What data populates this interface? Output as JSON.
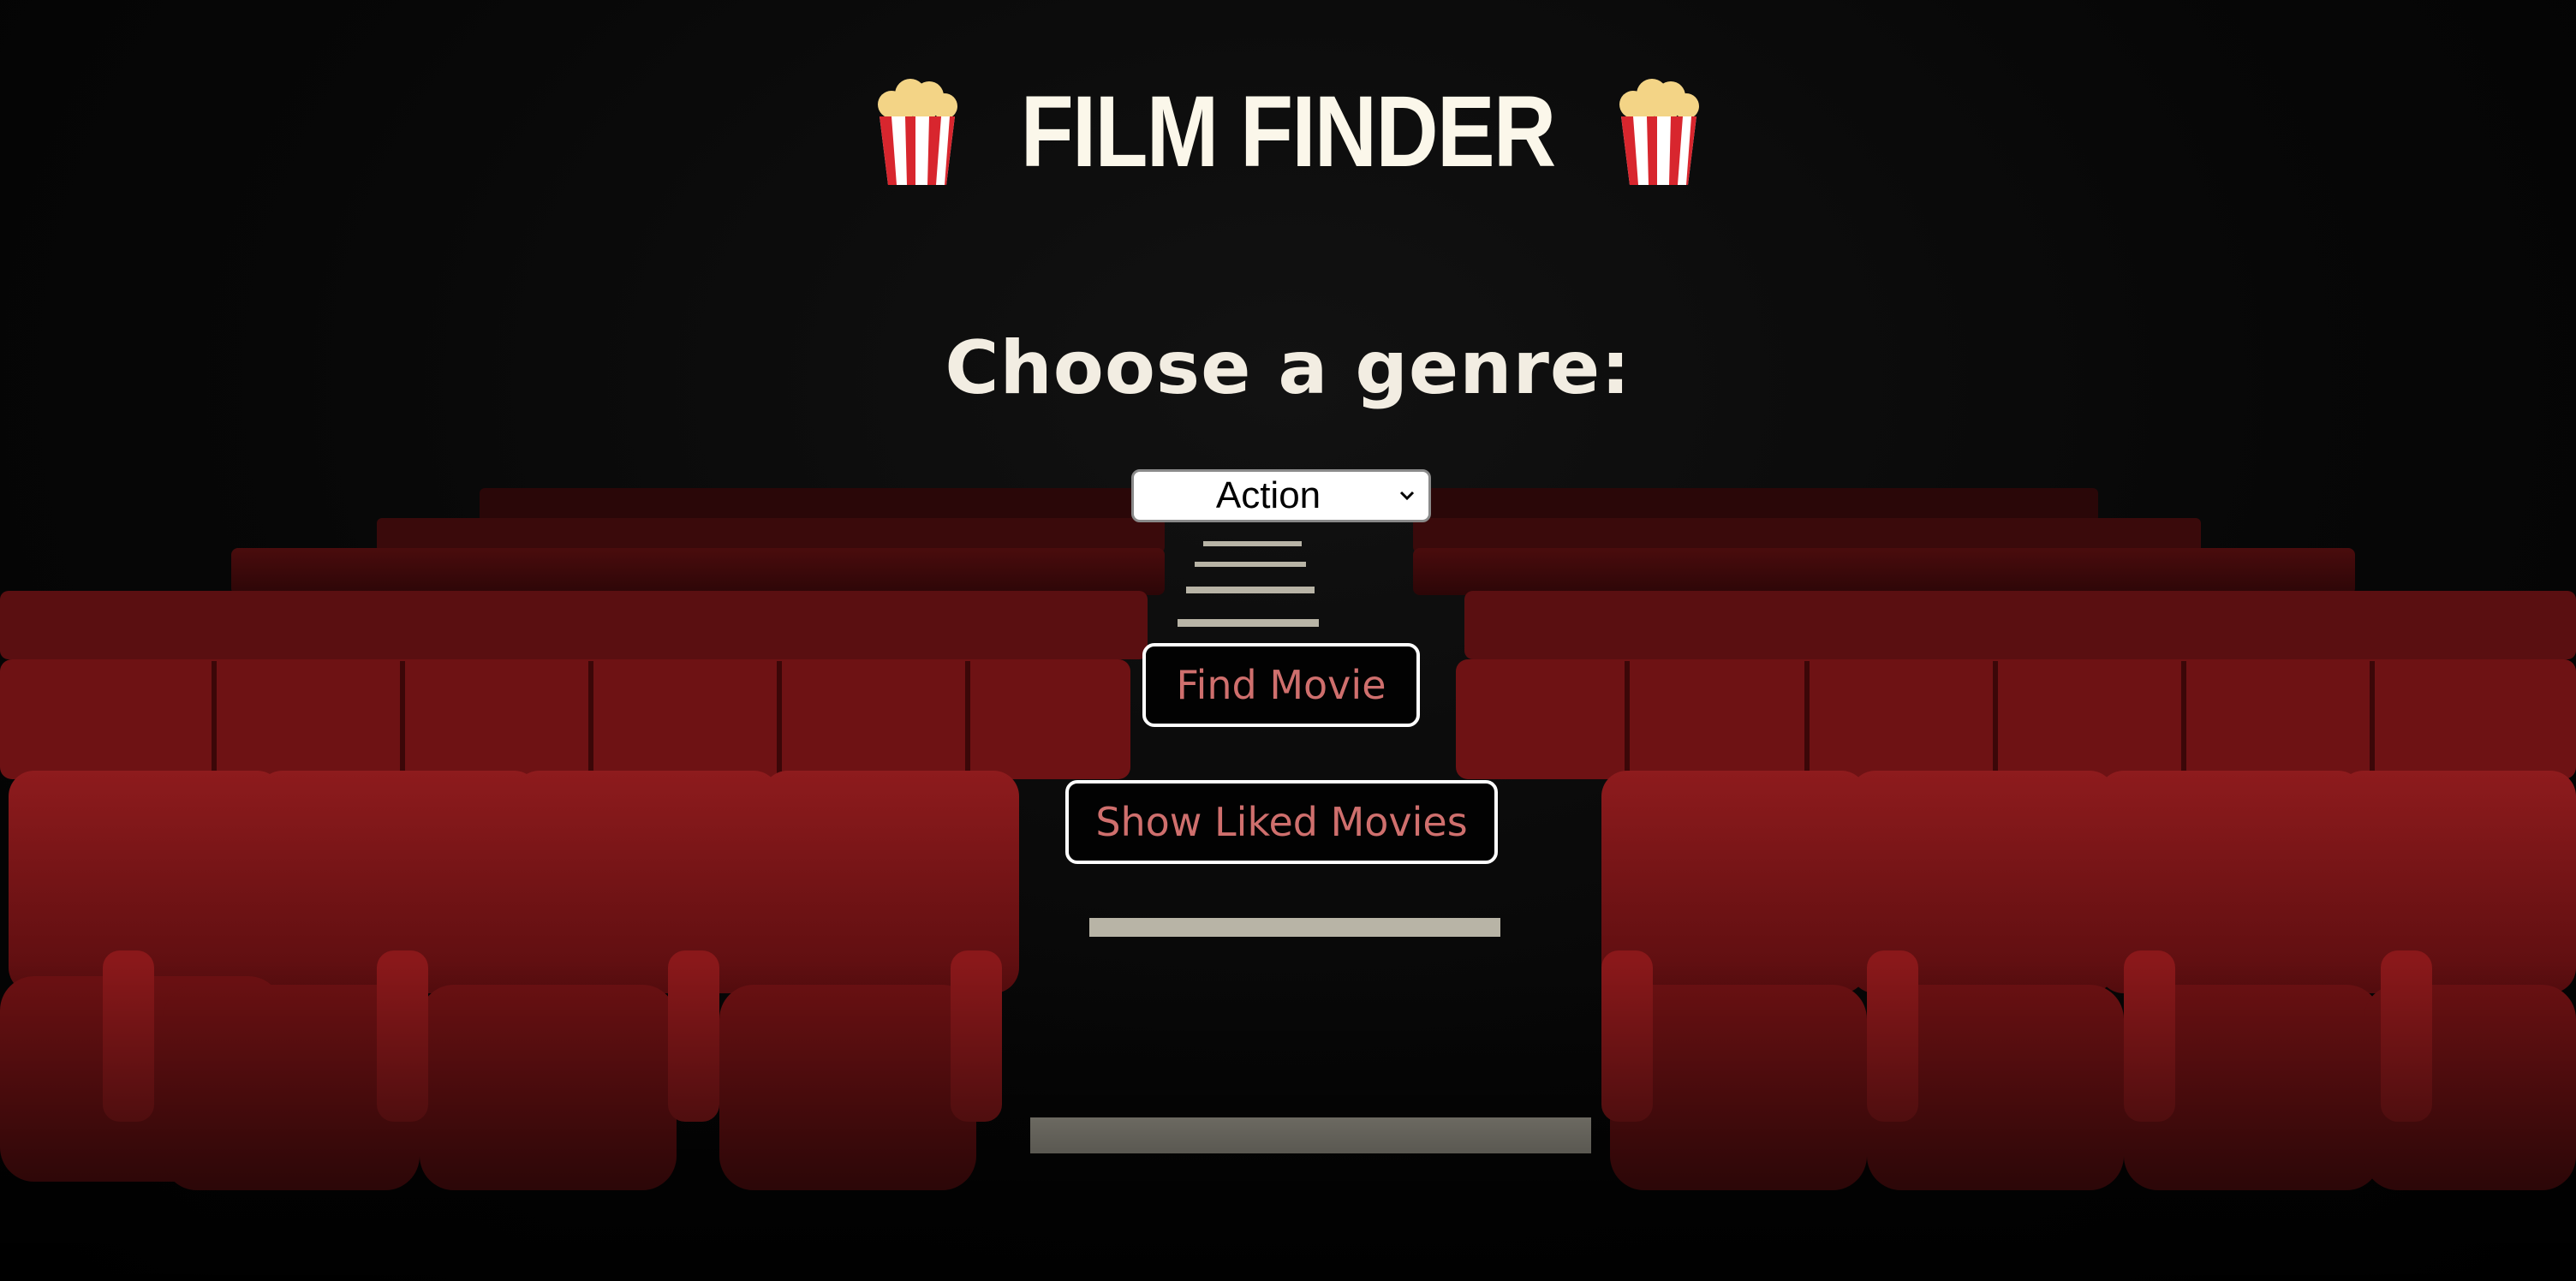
{
  "header": {
    "title": "FILM FINDER",
    "icon_left": "popcorn-icon",
    "icon_right": "popcorn-icon"
  },
  "genre": {
    "heading": "Choose a genre:",
    "selected": "Action"
  },
  "buttons": {
    "find_label": "Find Movie",
    "liked_label": "Show Liked Movies"
  },
  "colors": {
    "title": "#fbf7ea",
    "button_text": "#cf6f6d",
    "seat_red": "#7d1416",
    "background": "#050505"
  }
}
